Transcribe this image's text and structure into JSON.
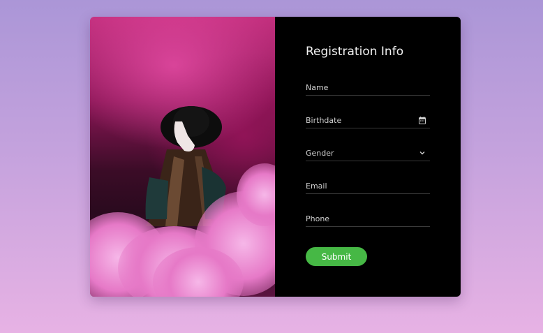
{
  "form": {
    "title": "Registration Info",
    "fields": [
      {
        "label": "Name",
        "icon": "none"
      },
      {
        "label": "Birthdate",
        "icon": "calendar-icon"
      },
      {
        "label": "Gender",
        "icon": "chevron-down-icon"
      },
      {
        "label": "Email",
        "icon": "none"
      },
      {
        "label": "Phone",
        "icon": "none"
      }
    ],
    "submit_label": "Submit"
  },
  "colors": {
    "background_top": "#ab96d7",
    "background_bottom": "#e7b2e4",
    "panel": "#000000",
    "submit": "#46b845",
    "photo_accent": "#c4307f"
  }
}
